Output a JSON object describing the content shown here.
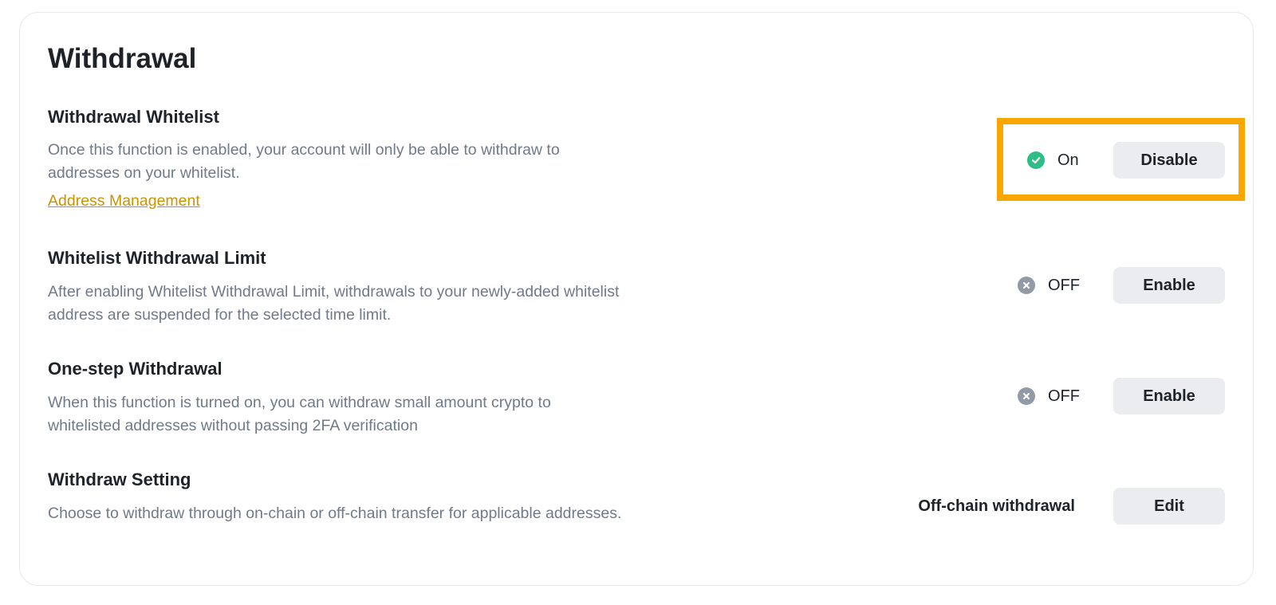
{
  "page": {
    "title": "Withdrawal"
  },
  "settings": [
    {
      "title": "Withdrawal Whitelist",
      "description": "Once this function is enabled, your account will only be able to withdraw to addresses on your whitelist.",
      "link": "Address Management",
      "status": "On",
      "status_icon": "check-circle-icon",
      "button": "Disable"
    },
    {
      "title": "Whitelist Withdrawal Limit",
      "description": "After enabling Whitelist Withdrawal Limit, withdrawals to your newly-added whitelist address are suspended for the selected time limit.",
      "status": "OFF",
      "status_icon": "x-circle-icon",
      "button": "Enable"
    },
    {
      "title": "One-step Withdrawal",
      "description": "When this function is turned on, you can withdraw small amount crypto to whitelisted addresses without passing 2FA verification",
      "status": "OFF",
      "status_icon": "x-circle-icon",
      "button": "Enable"
    },
    {
      "title": "Withdraw Setting",
      "description": "Choose to withdraw through on-chain or off-chain transfer for applicable addresses.",
      "value": "Off-chain withdrawal",
      "button": "Edit"
    }
  ],
  "colors": {
    "on": "#2ebd85",
    "off": "#929aa5",
    "link": "#c99400",
    "highlight": "#f9a600",
    "button_bg": "#eaecef"
  }
}
